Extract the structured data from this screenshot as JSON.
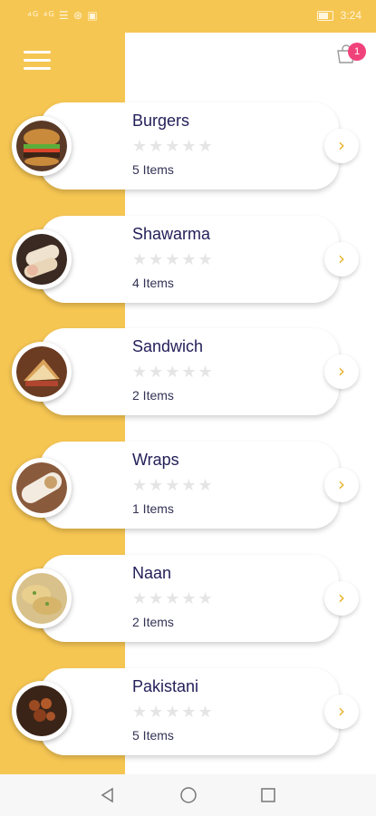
{
  "status": {
    "left_text": "⁴ᴳ ⁴ᴳ ☰ ⊛ ▣",
    "time": "3:24"
  },
  "header": {
    "menu_icon": "hamburger-menu-icon",
    "cart_icon": "shopping-bag-icon",
    "cart_count": "1"
  },
  "categories": [
    {
      "name": "Burgers",
      "stars": "★★★★★",
      "count": "5 Items",
      "image": "burger"
    },
    {
      "name": "Shawarma",
      "stars": "★★★★★",
      "count": "4 Items",
      "image": "shawarma"
    },
    {
      "name": "Sandwich",
      "stars": "★★★★★",
      "count": "2 Items",
      "image": "sandwich"
    },
    {
      "name": "Wraps",
      "stars": "★★★★★",
      "count": "1 Items",
      "image": "wrap"
    },
    {
      "name": "Naan",
      "stars": "★★★★★",
      "count": "2 Items",
      "image": "naan"
    },
    {
      "name": "Pakistani",
      "stars": "★★★★★",
      "count": "5 Items",
      "image": "curry"
    }
  ],
  "arrow": "›",
  "colors": {
    "accent": "#f6c653",
    "title": "#24205a",
    "badge": "#f0427a"
  }
}
